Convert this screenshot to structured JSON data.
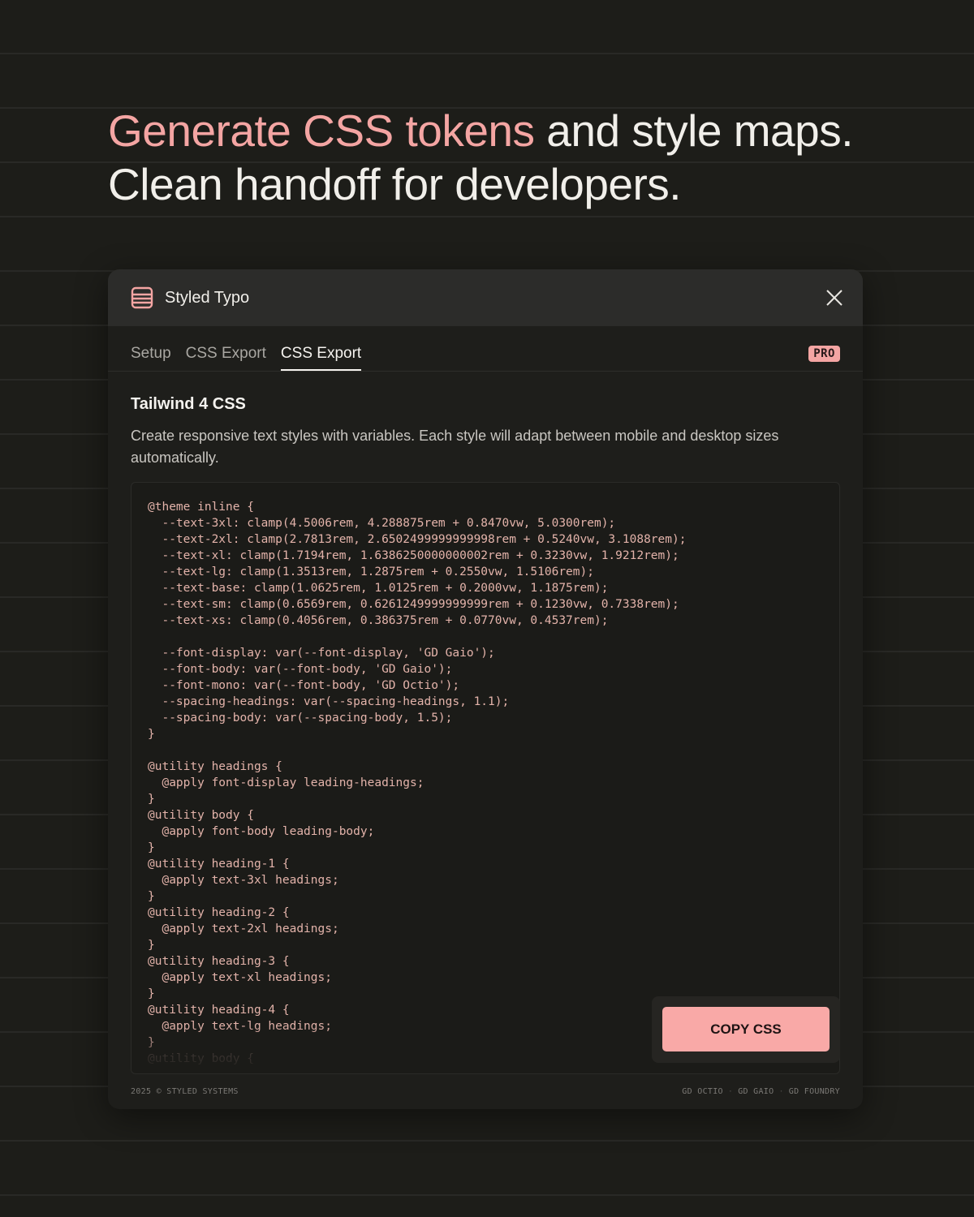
{
  "headline": {
    "accent": "Generate CSS tokens",
    "rest_line1": " and style maps.",
    "line2": "Clean handoff for developers."
  },
  "colors": {
    "background": "#1d1d19",
    "accent": "#f4a5a3",
    "button": "#f9a9a7",
    "code_text": "#e3b3aa"
  },
  "window": {
    "icon": "layers-icon",
    "title": "Styled Typo",
    "close_icon": "close-icon"
  },
  "tabs": [
    {
      "label": "Setup",
      "active": false
    },
    {
      "label": "CSS Export",
      "active": false
    },
    {
      "label": "CSS Export",
      "active": true
    }
  ],
  "badge": "PRO",
  "section": {
    "title": "Tailwind 4 CSS",
    "description": "Create responsive text styles with variables. Each style will adapt between mobile and desktop sizes automatically."
  },
  "code_lines": [
    "@theme inline {",
    "  --text-3xl: clamp(4.5006rem, 4.288875rem + 0.8470vw, 5.0300rem);",
    "  --text-2xl: clamp(2.7813rem, 2.6502499999999998rem + 0.5240vw, 3.1088rem);",
    "  --text-xl: clamp(1.7194rem, 1.6386250000000002rem + 0.3230vw, 1.9212rem);",
    "  --text-lg: clamp(1.3513rem, 1.2875rem + 0.2550vw, 1.5106rem);",
    "  --text-base: clamp(1.0625rem, 1.0125rem + 0.2000vw, 1.1875rem);",
    "  --text-sm: clamp(0.6569rem, 0.6261249999999999rem + 0.1230vw, 0.7338rem);",
    "  --text-xs: clamp(0.4056rem, 0.386375rem + 0.0770vw, 0.4537rem);",
    "",
    "  --font-display: var(--font-display, 'GD Gaio');",
    "  --font-body: var(--font-body, 'GD Gaio');",
    "  --font-mono: var(--font-body, 'GD Octio');",
    "  --spacing-headings: var(--spacing-headings, 1.1);",
    "  --spacing-body: var(--spacing-body, 1.5);",
    "}",
    "",
    "@utility headings {",
    "  @apply font-display leading-headings;",
    "}",
    "@utility body {",
    "  @apply font-body leading-body;",
    "}",
    "@utility heading-1 {",
    "  @apply text-3xl headings;",
    "}",
    "@utility heading-2 {",
    "  @apply text-2xl headings;",
    "}",
    "@utility heading-3 {",
    "  @apply text-xl headings;",
    "}",
    "@utility heading-4 {",
    "  @apply text-lg headings;",
    "}",
    "@utility body {"
  ],
  "copy_button": "COPY CSS",
  "footer": {
    "left": "2025 © STYLED SYSTEMS",
    "links": [
      "GD OCTIO",
      "GD GAIO",
      "GD FOUNDRY"
    ]
  }
}
